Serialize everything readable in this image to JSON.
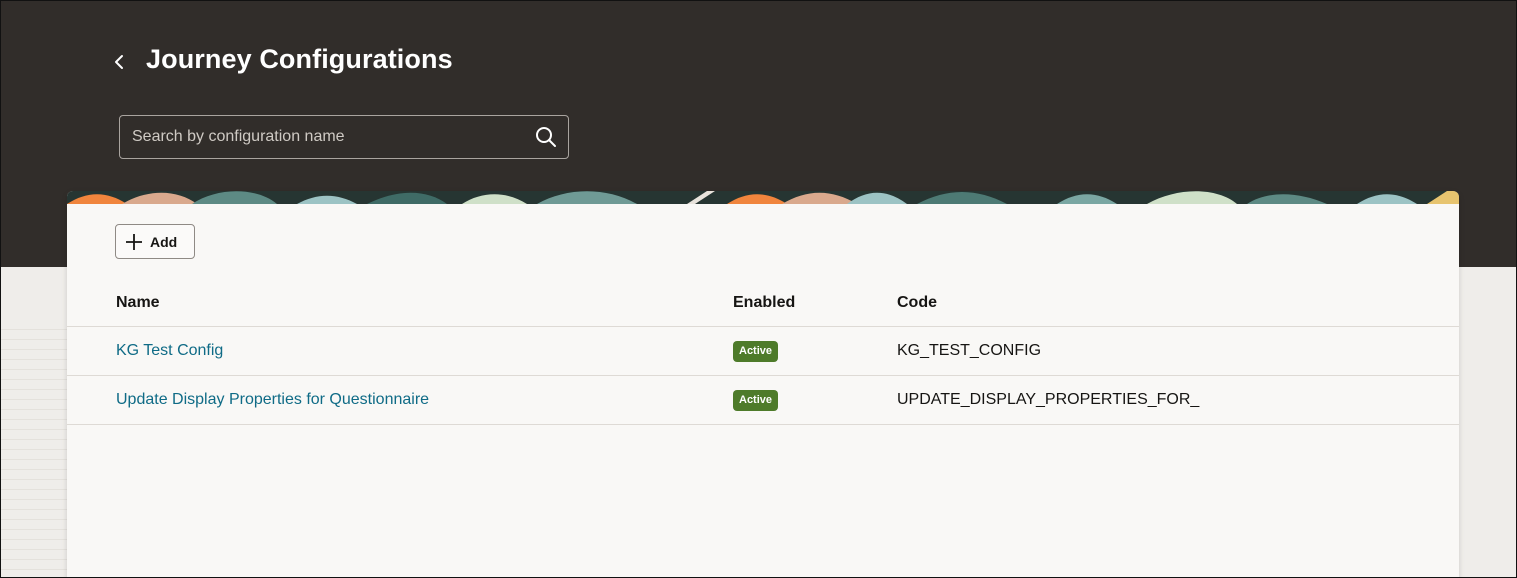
{
  "header": {
    "title": "Journey Configurations",
    "back_icon": "chevron-left-icon"
  },
  "search": {
    "placeholder": "Search by configuration name",
    "value": "",
    "icon": "search-icon"
  },
  "toolbar": {
    "add_label": "Add",
    "add_icon": "plus-icon"
  },
  "table": {
    "columns": [
      "Name",
      "Enabled",
      "Code"
    ],
    "rows": [
      {
        "name": "KG Test Config",
        "enabled": "Active",
        "code": "KG_TEST_CONFIG"
      },
      {
        "name": "Update Display Properties for Questionnaire",
        "enabled": "Active",
        "code": "UPDATE_DISPLAY_PROPERTIES_FOR_"
      }
    ]
  },
  "colors": {
    "header_bg": "#312d2a",
    "card_bg": "#f9f8f6",
    "link": "#0f6b86",
    "active_badge": "#4e7b2a"
  }
}
